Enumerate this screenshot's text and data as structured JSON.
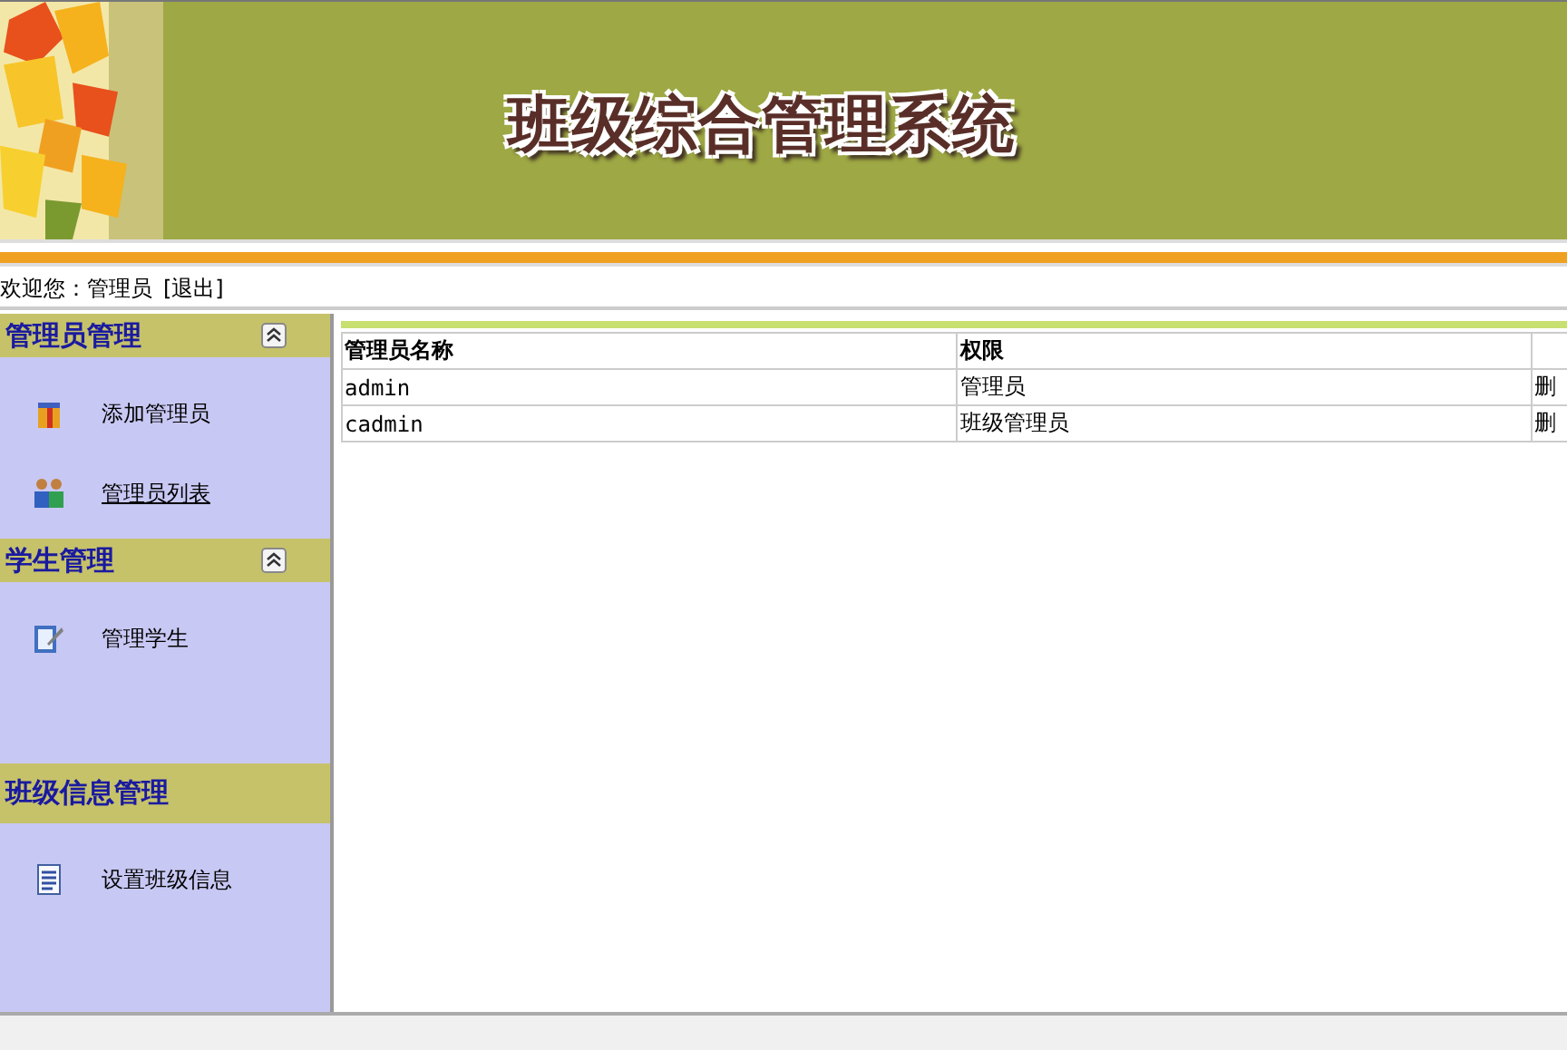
{
  "header": {
    "title": "班级综合管理系统"
  },
  "welcome": {
    "text": "欢迎您：管理员",
    "logout": "[退出]"
  },
  "sidebar": {
    "sections": [
      {
        "title": "管理员管理",
        "collapsible": true,
        "items": [
          {
            "label": "添加管理员",
            "kind": "gift",
            "selected": false
          },
          {
            "label": "管理员列表",
            "kind": "people",
            "selected": true
          }
        ]
      },
      {
        "title": "学生管理",
        "collapsible": true,
        "items": [
          {
            "label": "管理学生",
            "kind": "edit",
            "selected": false
          }
        ]
      },
      {
        "title": "班级信息管理",
        "collapsible": false,
        "items": [
          {
            "label": "设置班级信息",
            "kind": "document",
            "selected": false
          }
        ]
      }
    ]
  },
  "table": {
    "columns": [
      "管理员名称",
      "权限"
    ],
    "rows": [
      {
        "name": "admin",
        "role": "管理员",
        "action": "删"
      },
      {
        "name": "cadmin",
        "role": "班级管理员",
        "action": "删"
      }
    ]
  }
}
